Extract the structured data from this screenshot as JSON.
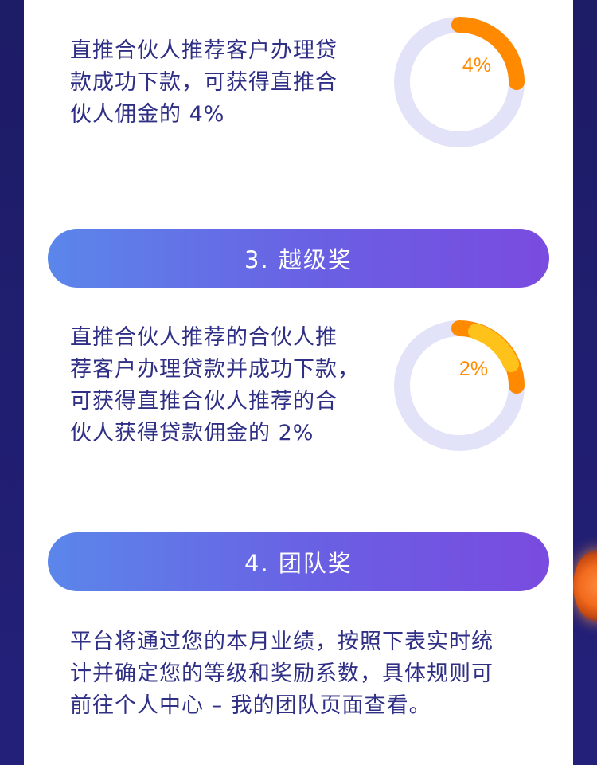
{
  "section_direct": {
    "lines": [
      "直推合伙人推荐客户办理贷",
      "款成功下款，可获得直推合",
      "伙人佣金的 4%"
    ],
    "percent_label": "4%",
    "percent_value": 4
  },
  "section_3": {
    "heading": "3. 越级奖",
    "lines": [
      "直推合伙人推荐的合伙人推",
      "荐客户办理贷款并成功下款，",
      "可获得直推合伙人推荐的合",
      "伙人获得贷款佣金的 2%"
    ],
    "percent_label": "2%",
    "percent_value": 2
  },
  "section_4": {
    "heading": "4. 团队奖",
    "lines": [
      "平台将通过您的本月业绩，按照下表实时统",
      "计并确定您的等级和奖励系数，具体规则可",
      "前往个人中心 – 我的团队页面查看。"
    ]
  },
  "colors": {
    "text": "#2f2f86",
    "ring_track": "#e2e3f8",
    "ring_orange": "#ff8a00",
    "ring_yellow": "#ffc21a",
    "pill_start": "#5b86ea",
    "pill_end": "#7a4be0",
    "background": "#1f1e6b"
  }
}
